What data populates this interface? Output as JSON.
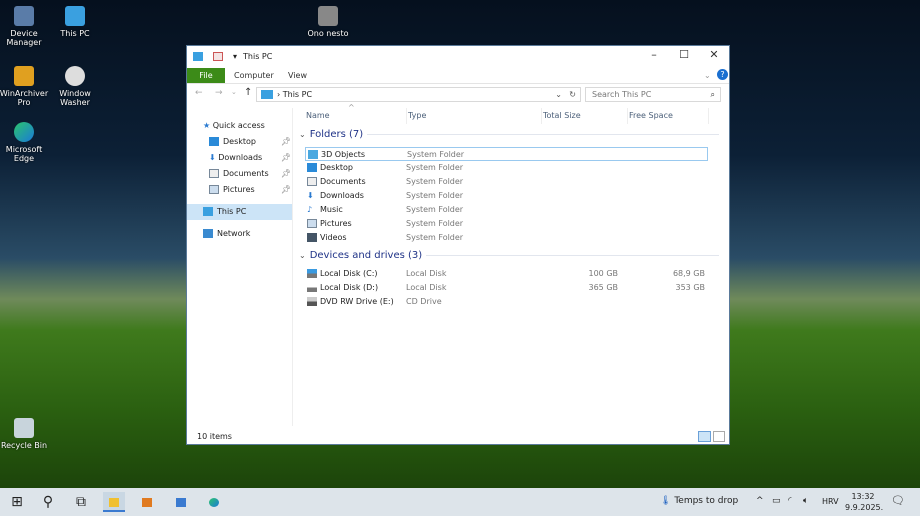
{
  "desktop": {
    "icons": [
      {
        "label": "Device Manager",
        "icon": "device-manager-icon"
      },
      {
        "label": "This PC",
        "icon": "this-pc-icon"
      },
      {
        "label": "Ono nesto",
        "icon": "media-icon"
      },
      {
        "label": "WinArchiver Pro",
        "icon": "archive-icon"
      },
      {
        "label": "Window Washer",
        "icon": "washer-icon"
      },
      {
        "label": "Microsoft Edge",
        "icon": "edge-icon"
      },
      {
        "label": "Recycle Bin",
        "icon": "recycle-bin-icon"
      }
    ]
  },
  "window": {
    "title": "This PC",
    "ribbon_tabs": [
      "File",
      "Computer",
      "View"
    ],
    "file_color": "#3c8b18",
    "address": "This PC",
    "search_placeholder": "Search This PC",
    "nav": {
      "quick_access": "Quick access",
      "items": [
        "Desktop",
        "Downloads",
        "Documents",
        "Pictures"
      ],
      "this_pc": "This PC",
      "network": "Network"
    },
    "columns": [
      "Name",
      "Type",
      "Total Size",
      "Free Space"
    ],
    "folders_header": "Folders (7)",
    "folders": [
      {
        "name": "3D Objects",
        "type": "System Folder"
      },
      {
        "name": "Desktop",
        "type": "System Folder"
      },
      {
        "name": "Documents",
        "type": "System Folder"
      },
      {
        "name": "Downloads",
        "type": "System Folder"
      },
      {
        "name": "Music",
        "type": "System Folder"
      },
      {
        "name": "Pictures",
        "type": "System Folder"
      },
      {
        "name": "Videos",
        "type": "System Folder"
      }
    ],
    "drives_header": "Devices and drives (3)",
    "drives": [
      {
        "name": "Local Disk (C:)",
        "type": "Local Disk",
        "total": "100 GB",
        "free": "68,9 GB"
      },
      {
        "name": "Local Disk (D:)",
        "type": "Local Disk",
        "total": "365 GB",
        "free": "353 GB"
      },
      {
        "name": "DVD RW Drive (E:)",
        "type": "CD Drive",
        "total": "",
        "free": ""
      }
    ],
    "status": "10 items"
  },
  "taskbar": {
    "weather": "Temps to drop",
    "lang": "HRV",
    "time": "13:32",
    "date": "9.9.2025."
  }
}
